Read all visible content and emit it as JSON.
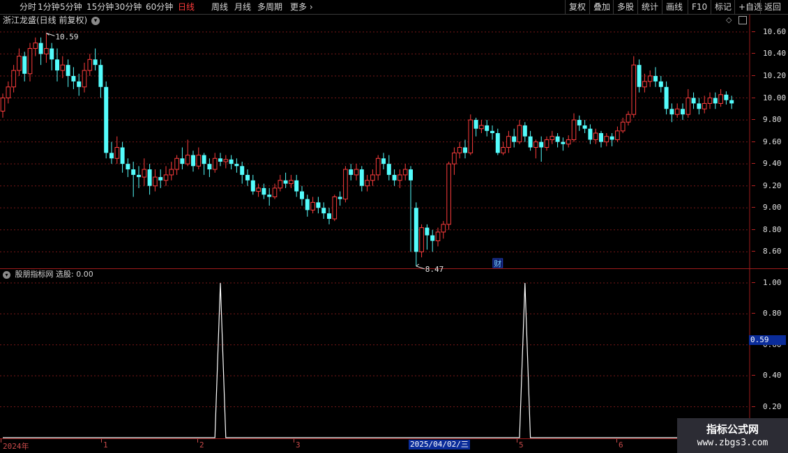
{
  "toolbar": {
    "periods": [
      "分时",
      "1分钟",
      "5分钟",
      "15分钟",
      "30分钟",
      "60分钟",
      "日线",
      "周线",
      "月线",
      "多周期",
      "更多"
    ],
    "active": "日线",
    "more_arrow": "›",
    "right_buttons": [
      "复权",
      "叠加",
      "多股",
      "统计",
      "画线",
      "F10",
      "标记",
      "+自选",
      "返回"
    ]
  },
  "stock": {
    "title": "浙江龙盛(日线 前复权)",
    "max_label": "10.59",
    "min_label": "8.47",
    "fin_marker": "财"
  },
  "price_axis": [
    "10.60",
    "10.40",
    "10.20",
    "10.00",
    "9.80",
    "9.60",
    "9.40",
    "9.20",
    "9.00",
    "8.80",
    "8.60"
  ],
  "indicator": {
    "title": "股朋指标网 选股: 0.00",
    "axis": [
      "1.00",
      "0.80",
      "0.60",
      "0.40",
      "0.20"
    ],
    "cursor_value": "0.59",
    "signal_days": [
      40,
      96
    ]
  },
  "date_axis": {
    "labels": [
      "2024年",
      "1",
      "2",
      "3",
      "4",
      "5",
      "6"
    ],
    "cursor_date": "2025/04/02/三"
  },
  "watermark": {
    "line1": "指标公式网",
    "line2": "www.zbgs3.com"
  },
  "colors": {
    "up": "#ff3d3d",
    "down": "#54fcfc",
    "grid": "#7a1818",
    "border": "#a01c1c"
  },
  "chart_data": {
    "type": "candlestick",
    "ylim": [
      8.45,
      10.65
    ],
    "candles": [
      [
        9.88,
        10.0,
        9.82,
        10.04
      ],
      [
        10.0,
        10.1,
        9.95,
        10.15
      ],
      [
        10.1,
        10.25,
        10.05,
        10.3
      ],
      [
        10.25,
        10.38,
        10.2,
        10.45
      ],
      [
        10.38,
        10.22,
        10.15,
        10.42
      ],
      [
        10.22,
        10.45,
        10.15,
        10.5
      ],
      [
        10.45,
        10.5,
        10.38,
        10.55
      ],
      [
        10.5,
        10.4,
        10.3,
        10.55
      ],
      [
        10.4,
        10.45,
        10.32,
        10.59
      ],
      [
        10.45,
        10.35,
        10.25,
        10.5
      ],
      [
        10.35,
        10.25,
        10.15,
        10.45
      ],
      [
        10.25,
        10.3,
        10.18,
        10.38
      ],
      [
        10.3,
        10.2,
        10.1,
        10.35
      ],
      [
        10.2,
        10.15,
        10.08,
        10.28
      ],
      [
        10.15,
        10.1,
        10.02,
        10.22
      ],
      [
        10.1,
        10.25,
        10.05,
        10.32
      ],
      [
        10.25,
        10.35,
        10.2,
        10.4
      ],
      [
        10.35,
        10.3,
        10.25,
        10.45
      ],
      [
        10.3,
        10.1,
        10.0,
        10.35
      ],
      [
        10.1,
        9.5,
        9.45,
        10.15
      ],
      [
        9.5,
        9.45,
        9.4,
        9.6
      ],
      [
        9.45,
        9.55,
        9.4,
        9.65
      ],
      [
        9.55,
        9.4,
        9.32,
        9.6
      ],
      [
        9.4,
        9.35,
        9.28,
        9.45
      ],
      [
        9.35,
        9.3,
        9.1,
        9.42
      ],
      [
        9.3,
        9.28,
        9.18,
        9.38
      ],
      [
        9.28,
        9.35,
        9.2,
        9.45
      ],
      [
        9.35,
        9.2,
        9.12,
        9.4
      ],
      [
        9.2,
        9.28,
        9.15,
        9.35
      ],
      [
        9.28,
        9.25,
        9.18,
        9.35
      ],
      [
        9.25,
        9.3,
        9.2,
        9.38
      ],
      [
        9.3,
        9.35,
        9.25,
        9.42
      ],
      [
        9.35,
        9.45,
        9.3,
        9.48
      ],
      [
        9.45,
        9.4,
        9.35,
        9.55
      ],
      [
        9.4,
        9.48,
        9.38,
        9.62
      ],
      [
        9.48,
        9.38,
        9.33,
        9.52
      ],
      [
        9.38,
        9.48,
        9.35,
        9.55
      ],
      [
        9.48,
        9.4,
        9.3,
        9.5
      ],
      [
        9.4,
        9.35,
        9.28,
        9.45
      ],
      [
        9.35,
        9.45,
        9.32,
        9.5
      ],
      [
        9.45,
        9.42,
        9.38,
        9.5
      ],
      [
        9.42,
        9.44,
        9.36,
        9.48
      ],
      [
        9.44,
        9.4,
        9.35,
        9.48
      ],
      [
        9.4,
        9.38,
        9.32,
        9.45
      ],
      [
        9.38,
        9.3,
        9.22,
        9.42
      ],
      [
        9.3,
        9.25,
        9.2,
        9.35
      ],
      [
        9.25,
        9.15,
        9.12,
        9.3
      ],
      [
        9.15,
        9.18,
        9.1,
        9.22
      ],
      [
        9.18,
        9.12,
        9.08,
        9.22
      ],
      [
        9.12,
        9.1,
        9.02,
        9.18
      ],
      [
        9.1,
        9.18,
        9.08,
        9.22
      ],
      [
        9.18,
        9.25,
        9.15,
        9.3
      ],
      [
        9.25,
        9.22,
        9.18,
        9.32
      ],
      [
        9.22,
        9.25,
        9.18,
        9.3
      ],
      [
        9.25,
        9.15,
        9.1,
        9.3
      ],
      [
        9.15,
        9.08,
        9.02,
        9.2
      ],
      [
        9.08,
        8.98,
        8.92,
        9.12
      ],
      [
        8.98,
        9.05,
        8.95,
        9.1
      ],
      [
        9.05,
        9.0,
        8.95,
        9.1
      ],
      [
        9.0,
        8.95,
        8.9,
        9.05
      ],
      [
        8.95,
        8.9,
        8.85,
        9.0
      ],
      [
        8.9,
        9.1,
        8.88,
        9.12
      ],
      [
        9.1,
        9.08,
        9.02,
        9.15
      ],
      [
        9.08,
        9.35,
        9.05,
        9.38
      ],
      [
        9.35,
        9.3,
        9.25,
        9.4
      ],
      [
        9.3,
        9.35,
        9.25,
        9.4
      ],
      [
        9.35,
        9.2,
        9.15,
        9.38
      ],
      [
        9.2,
        9.25,
        9.15,
        9.3
      ],
      [
        9.25,
        9.3,
        9.2,
        9.35
      ],
      [
        9.3,
        9.45,
        9.25,
        9.48
      ],
      [
        9.45,
        9.4,
        9.35,
        9.5
      ],
      [
        9.4,
        9.3,
        9.25,
        9.48
      ],
      [
        9.3,
        9.25,
        9.2,
        9.35
      ],
      [
        9.25,
        9.3,
        9.18,
        9.35
      ],
      [
        9.3,
        9.35,
        9.25,
        9.4
      ],
      [
        9.35,
        9.25,
        8.6,
        9.38
      ],
      [
        9.0,
        8.6,
        8.47,
        9.05
      ],
      [
        8.6,
        8.82,
        8.55,
        8.85
      ],
      [
        8.82,
        8.75,
        8.62,
        8.85
      ],
      [
        8.75,
        8.7,
        8.6,
        8.8
      ],
      [
        8.7,
        8.78,
        8.65,
        8.82
      ],
      [
        8.78,
        8.85,
        8.72,
        8.88
      ],
      [
        8.85,
        9.4,
        8.8,
        9.42
      ],
      [
        9.4,
        9.5,
        9.3,
        9.55
      ],
      [
        9.5,
        9.55,
        9.45,
        9.6
      ],
      [
        9.55,
        9.5,
        9.45,
        9.62
      ],
      [
        9.5,
        9.8,
        9.48,
        9.85
      ],
      [
        9.8,
        9.72,
        9.65,
        9.82
      ],
      [
        9.72,
        9.75,
        9.68,
        9.8
      ],
      [
        9.75,
        9.7,
        9.65,
        9.8
      ],
      [
        9.7,
        9.68,
        9.62,
        9.75
      ],
      [
        9.68,
        9.5,
        9.48,
        9.72
      ],
      [
        9.5,
        9.55,
        9.48,
        9.6
      ],
      [
        9.55,
        9.65,
        9.5,
        9.7
      ],
      [
        9.65,
        9.6,
        9.55,
        9.72
      ],
      [
        9.6,
        9.75,
        9.58,
        9.8
      ],
      [
        9.75,
        9.65,
        9.6,
        9.78
      ],
      [
        9.65,
        9.55,
        9.52,
        9.7
      ],
      [
        9.55,
        9.6,
        9.45,
        9.62
      ],
      [
        9.6,
        9.55,
        9.42,
        9.65
      ],
      [
        9.55,
        9.62,
        9.52,
        9.65
      ],
      [
        9.62,
        9.65,
        9.58,
        9.7
      ],
      [
        9.65,
        9.6,
        9.55,
        9.68
      ],
      [
        9.6,
        9.58,
        9.52,
        9.64
      ],
      [
        9.58,
        9.62,
        9.55,
        9.66
      ],
      [
        9.62,
        9.8,
        9.6,
        9.86
      ],
      [
        9.8,
        9.75,
        9.7,
        9.84
      ],
      [
        9.75,
        9.72,
        9.68,
        9.8
      ],
      [
        9.72,
        9.62,
        9.58,
        9.76
      ],
      [
        9.62,
        9.68,
        9.58,
        9.72
      ],
      [
        9.68,
        9.6,
        9.55,
        9.7
      ],
      [
        9.6,
        9.65,
        9.56,
        9.68
      ],
      [
        9.65,
        9.62,
        9.56,
        9.68
      ],
      [
        9.62,
        9.7,
        9.6,
        9.74
      ],
      [
        9.7,
        9.78,
        9.68,
        9.82
      ],
      [
        9.78,
        9.85,
        9.75,
        9.88
      ],
      [
        9.85,
        10.3,
        9.82,
        10.38
      ],
      [
        10.3,
        10.1,
        10.05,
        10.35
      ],
      [
        10.1,
        10.15,
        10.05,
        10.22
      ],
      [
        10.15,
        10.2,
        10.1,
        10.25
      ],
      [
        10.2,
        10.15,
        10.1,
        10.28
      ],
      [
        10.15,
        10.1,
        10.05,
        10.2
      ],
      [
        10.1,
        9.9,
        9.85,
        10.15
      ],
      [
        9.9,
        9.85,
        9.78,
        9.95
      ],
      [
        9.85,
        9.9,
        9.82,
        9.95
      ],
      [
        9.9,
        9.85,
        9.8,
        9.95
      ],
      [
        9.85,
        10.0,
        9.82,
        10.08
      ],
      [
        10.0,
        9.95,
        9.9,
        10.05
      ],
      [
        9.95,
        9.9,
        9.85,
        10.0
      ],
      [
        9.9,
        9.95,
        9.86,
        10.02
      ],
      [
        9.95,
        10.0,
        9.9,
        10.05
      ],
      [
        10.0,
        9.95,
        9.9,
        10.05
      ],
      [
        9.95,
        10.03,
        9.92,
        10.08
      ],
      [
        10.03,
        9.98,
        9.94,
        10.06
      ],
      [
        9.98,
        9.95,
        9.9,
        10.02
      ]
    ],
    "indicator_series": "0 on all days except 1.00 at signal_days"
  }
}
